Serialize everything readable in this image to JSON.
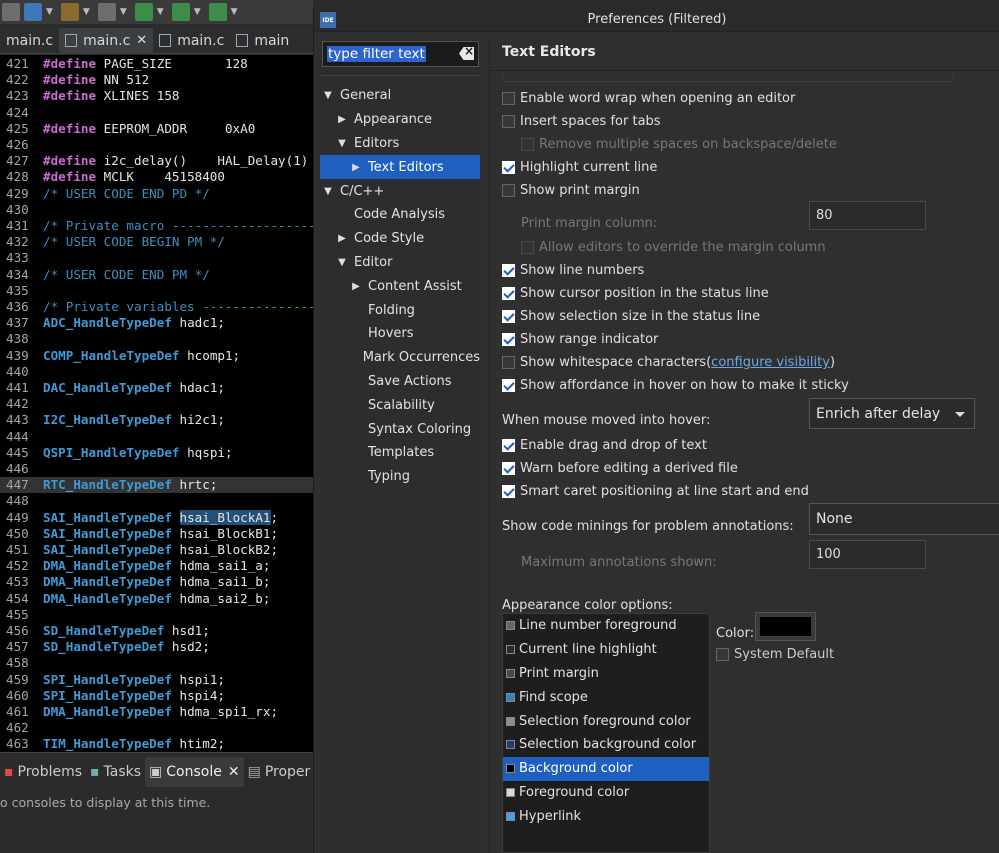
{
  "editor": {
    "tabs": [
      {
        "label": "main.c"
      },
      {
        "label": "main.c",
        "close": "✕"
      },
      {
        "label": "main.c"
      },
      {
        "label": "main"
      }
    ],
    "lines": [
      {
        "n": "421",
        "parts": [
          [
            "kw",
            "#define"
          ],
          [
            "t",
            " PAGE_SIZE       128"
          ]
        ]
      },
      {
        "n": "422",
        "parts": [
          [
            "kw",
            "#define"
          ],
          [
            "t",
            " NN 512"
          ]
        ]
      },
      {
        "n": "423",
        "parts": [
          [
            "kw",
            "#define"
          ],
          [
            "t",
            " XLINES 158"
          ]
        ]
      },
      {
        "n": "424",
        "parts": []
      },
      {
        "n": "425",
        "parts": [
          [
            "kw",
            "#define"
          ],
          [
            "t",
            " EEPROM_ADDR     0xA0"
          ]
        ]
      },
      {
        "n": "426",
        "parts": []
      },
      {
        "n": "427",
        "parts": [
          [
            "kw",
            "#define"
          ],
          [
            "t",
            " i2c_delay()    HAL_Delay(1)"
          ]
        ]
      },
      {
        "n": "428",
        "parts": [
          [
            "kw",
            "#define"
          ],
          [
            "t",
            " MCLK    45158400"
          ]
        ]
      },
      {
        "n": "429",
        "parts": [
          [
            "cm",
            "/* USER CODE END PD */"
          ]
        ]
      },
      {
        "n": "430",
        "parts": []
      },
      {
        "n": "431",
        "parts": [
          [
            "cm",
            "/* Private macro -------------------------------"
          ]
        ]
      },
      {
        "n": "432",
        "parts": [
          [
            "cm",
            "/* USER CODE BEGIN PM */"
          ]
        ]
      },
      {
        "n": "433",
        "parts": []
      },
      {
        "n": "434",
        "parts": [
          [
            "cm",
            "/* USER CODE END PM */"
          ]
        ]
      },
      {
        "n": "435",
        "parts": []
      },
      {
        "n": "436",
        "parts": [
          [
            "cm",
            "/* Private variables ---------------------------"
          ]
        ]
      },
      {
        "n": "437",
        "parts": [
          [
            "ty",
            "ADC_HandleTypeDef"
          ],
          [
            "t",
            " hadc1;"
          ]
        ]
      },
      {
        "n": "438",
        "parts": []
      },
      {
        "n": "439",
        "parts": [
          [
            "ty",
            "COMP_HandleTypeDef"
          ],
          [
            "t",
            " hcomp1;"
          ]
        ]
      },
      {
        "n": "440",
        "parts": []
      },
      {
        "n": "441",
        "parts": [
          [
            "ty",
            "DAC_HandleTypeDef"
          ],
          [
            "t",
            " hdac1;"
          ]
        ]
      },
      {
        "n": "442",
        "parts": []
      },
      {
        "n": "443",
        "parts": [
          [
            "ty",
            "I2C_HandleTypeDef"
          ],
          [
            "t",
            " hi2c1;"
          ]
        ]
      },
      {
        "n": "444",
        "parts": []
      },
      {
        "n": "445",
        "parts": [
          [
            "ty",
            "QSPI_HandleTypeDef"
          ],
          [
            "t",
            " hqspi;"
          ]
        ]
      },
      {
        "n": "446",
        "parts": []
      },
      {
        "n": "447",
        "parts": [
          [
            "ty",
            "RTC_HandleTypeDef"
          ],
          [
            "t",
            " hrtc;"
          ]
        ],
        "current": true
      },
      {
        "n": "448",
        "parts": []
      },
      {
        "n": "449",
        "parts": [
          [
            "ty",
            "SAI_HandleTypeDef"
          ],
          [
            "t",
            " "
          ],
          [
            "sel",
            "hsai_BlockA1"
          ],
          [
            "t",
            ";"
          ]
        ]
      },
      {
        "n": "450",
        "parts": [
          [
            "ty",
            "SAI_HandleTypeDef"
          ],
          [
            "t",
            " hsai_BlockB1;"
          ]
        ]
      },
      {
        "n": "451",
        "parts": [
          [
            "ty",
            "SAI_HandleTypeDef"
          ],
          [
            "t",
            " hsai_BlockB2;"
          ]
        ]
      },
      {
        "n": "452",
        "parts": [
          [
            "ty",
            "DMA_HandleTypeDef"
          ],
          [
            "t",
            " hdma_sai1_a;"
          ]
        ]
      },
      {
        "n": "453",
        "parts": [
          [
            "ty",
            "DMA_HandleTypeDef"
          ],
          [
            "t",
            " hdma_sai1_b;"
          ]
        ]
      },
      {
        "n": "454",
        "parts": [
          [
            "ty",
            "DMA_HandleTypeDef"
          ],
          [
            "t",
            " hdma_sai2_b;"
          ]
        ]
      },
      {
        "n": "455",
        "parts": []
      },
      {
        "n": "456",
        "parts": [
          [
            "ty",
            "SD_HandleTypeDef"
          ],
          [
            "t",
            " hsd1;"
          ]
        ]
      },
      {
        "n": "457",
        "parts": [
          [
            "ty",
            "SD_HandleTypeDef"
          ],
          [
            "t",
            " hsd2;"
          ]
        ]
      },
      {
        "n": "458",
        "parts": []
      },
      {
        "n": "459",
        "parts": [
          [
            "ty",
            "SPI_HandleTypeDef"
          ],
          [
            "t",
            " hspi1;"
          ]
        ]
      },
      {
        "n": "460",
        "parts": [
          [
            "ty",
            "SPI_HandleTypeDef"
          ],
          [
            "t",
            " hspi4;"
          ]
        ]
      },
      {
        "n": "461",
        "parts": [
          [
            "ty",
            "DMA_HandleTypeDef"
          ],
          [
            "t",
            " hdma_spi1_rx;"
          ]
        ]
      },
      {
        "n": "462",
        "parts": []
      },
      {
        "n": "463",
        "parts": [
          [
            "ty",
            "TIM_HandleTypeDef"
          ],
          [
            "t",
            " htim2;"
          ]
        ]
      }
    ]
  },
  "bottom_panel": {
    "tabs": [
      "Problems",
      "Tasks",
      "Console",
      "Proper"
    ],
    "close": "✕",
    "message": "o consoles to display at this time."
  },
  "dialog": {
    "badge": "IDE",
    "title": "Preferences (Filtered)",
    "filter_text": "type filter text",
    "tree": [
      {
        "label": "General",
        "twisty": "▼",
        "indent": 0
      },
      {
        "label": "Appearance",
        "twisty": "▶",
        "indent": 1
      },
      {
        "label": "Editors",
        "twisty": "▼",
        "indent": 1
      },
      {
        "label": "Text Editors",
        "twisty": "▶",
        "indent": 2,
        "selected": true
      },
      {
        "label": "C/C++",
        "twisty": "▼",
        "indent": 0
      },
      {
        "label": "Code Analysis",
        "twisty": "",
        "indent": 1
      },
      {
        "label": "Code Style",
        "twisty": "▶",
        "indent": 1
      },
      {
        "label": "Editor",
        "twisty": "▼",
        "indent": 1
      },
      {
        "label": "Content Assist",
        "twisty": "▶",
        "indent": 2
      },
      {
        "label": "Folding",
        "twisty": "",
        "indent": 2
      },
      {
        "label": "Hovers",
        "twisty": "",
        "indent": 2
      },
      {
        "label": "Mark Occurrences",
        "twisty": "",
        "indent": 2
      },
      {
        "label": "Save Actions",
        "twisty": "",
        "indent": 2
      },
      {
        "label": "Scalability",
        "twisty": "",
        "indent": 2
      },
      {
        "label": "Syntax Coloring",
        "twisty": "",
        "indent": 2
      },
      {
        "label": "Templates",
        "twisty": "",
        "indent": 2
      },
      {
        "label": "Typing",
        "twisty": "",
        "indent": 2
      }
    ],
    "page_title": "Text Editors",
    "checkboxes": [
      {
        "label": "Enable word wrap when opening an editor",
        "checked": false,
        "disabled": false,
        "indent": 0
      },
      {
        "label": "Insert spaces for tabs",
        "checked": false,
        "disabled": false,
        "indent": 0
      },
      {
        "label": "Remove multiple spaces on backspace/delete",
        "checked": false,
        "disabled": true,
        "indent": 1
      },
      {
        "label": "Highlight current line",
        "checked": true,
        "disabled": false,
        "indent": 0
      },
      {
        "label": "Show print margin",
        "checked": false,
        "disabled": false,
        "indent": 0
      },
      {
        "label": "Allow editors to override the margin column",
        "checked": false,
        "disabled": true,
        "indent": 1
      },
      {
        "label": "Show line numbers",
        "checked": true,
        "disabled": false,
        "indent": 0
      },
      {
        "label": "Show cursor position in the status line",
        "checked": true,
        "disabled": false,
        "indent": 0
      },
      {
        "label": "Show selection size in the status line",
        "checked": true,
        "disabled": false,
        "indent": 0
      },
      {
        "label": "Show range indicator",
        "checked": true,
        "disabled": false,
        "indent": 0
      },
      {
        "label": "Show whitespace characters",
        "checked": false,
        "disabled": false,
        "indent": 0,
        "link_prefix": " (",
        "link": "configure visibility",
        "link_suffix": ")"
      },
      {
        "label": "Show affordance in hover on how to make it sticky",
        "checked": true,
        "disabled": false,
        "indent": 0
      },
      {
        "label": "Enable drag and drop of text",
        "checked": true,
        "disabled": false,
        "indent": 0
      },
      {
        "label": "Warn before editing a derived file",
        "checked": true,
        "disabled": false,
        "indent": 0
      },
      {
        "label": "Smart caret positioning at line start and end",
        "checked": true,
        "disabled": false,
        "indent": 0
      }
    ],
    "print_margin_label": "Print margin column:",
    "print_margin_value": "80",
    "hover_label": "When mouse moved into hover:",
    "hover_value": "Enrich after delay",
    "minings_label": "Show code minings for problem annotations:",
    "minings_value": "None",
    "max_annotations_label": "Maximum annotations shown:",
    "max_annotations_value": "100",
    "appearance_label": "Appearance color options:",
    "color_options": [
      {
        "label": "Line number foreground",
        "swatch": "#5a6a75"
      },
      {
        "label": "Current line highlight",
        "swatch": "#2b2b2b"
      },
      {
        "label": "Print margin",
        "swatch": "#4a4a4a"
      },
      {
        "label": "Find scope",
        "swatch": "#2e86c1"
      },
      {
        "label": "Selection foreground color",
        "swatch": "#8c8c8c"
      },
      {
        "label": "Selection background color",
        "swatch": "#1f3f6e"
      },
      {
        "label": "Background color",
        "swatch": "#000000",
        "selected": true
      },
      {
        "label": "Foreground color",
        "swatch": "#d8d8d8"
      },
      {
        "label": "Hyperlink",
        "swatch": "#4a9bea"
      }
    ],
    "color_label": "Color:",
    "color_value": "#000000",
    "system_default_label": "System Default"
  }
}
